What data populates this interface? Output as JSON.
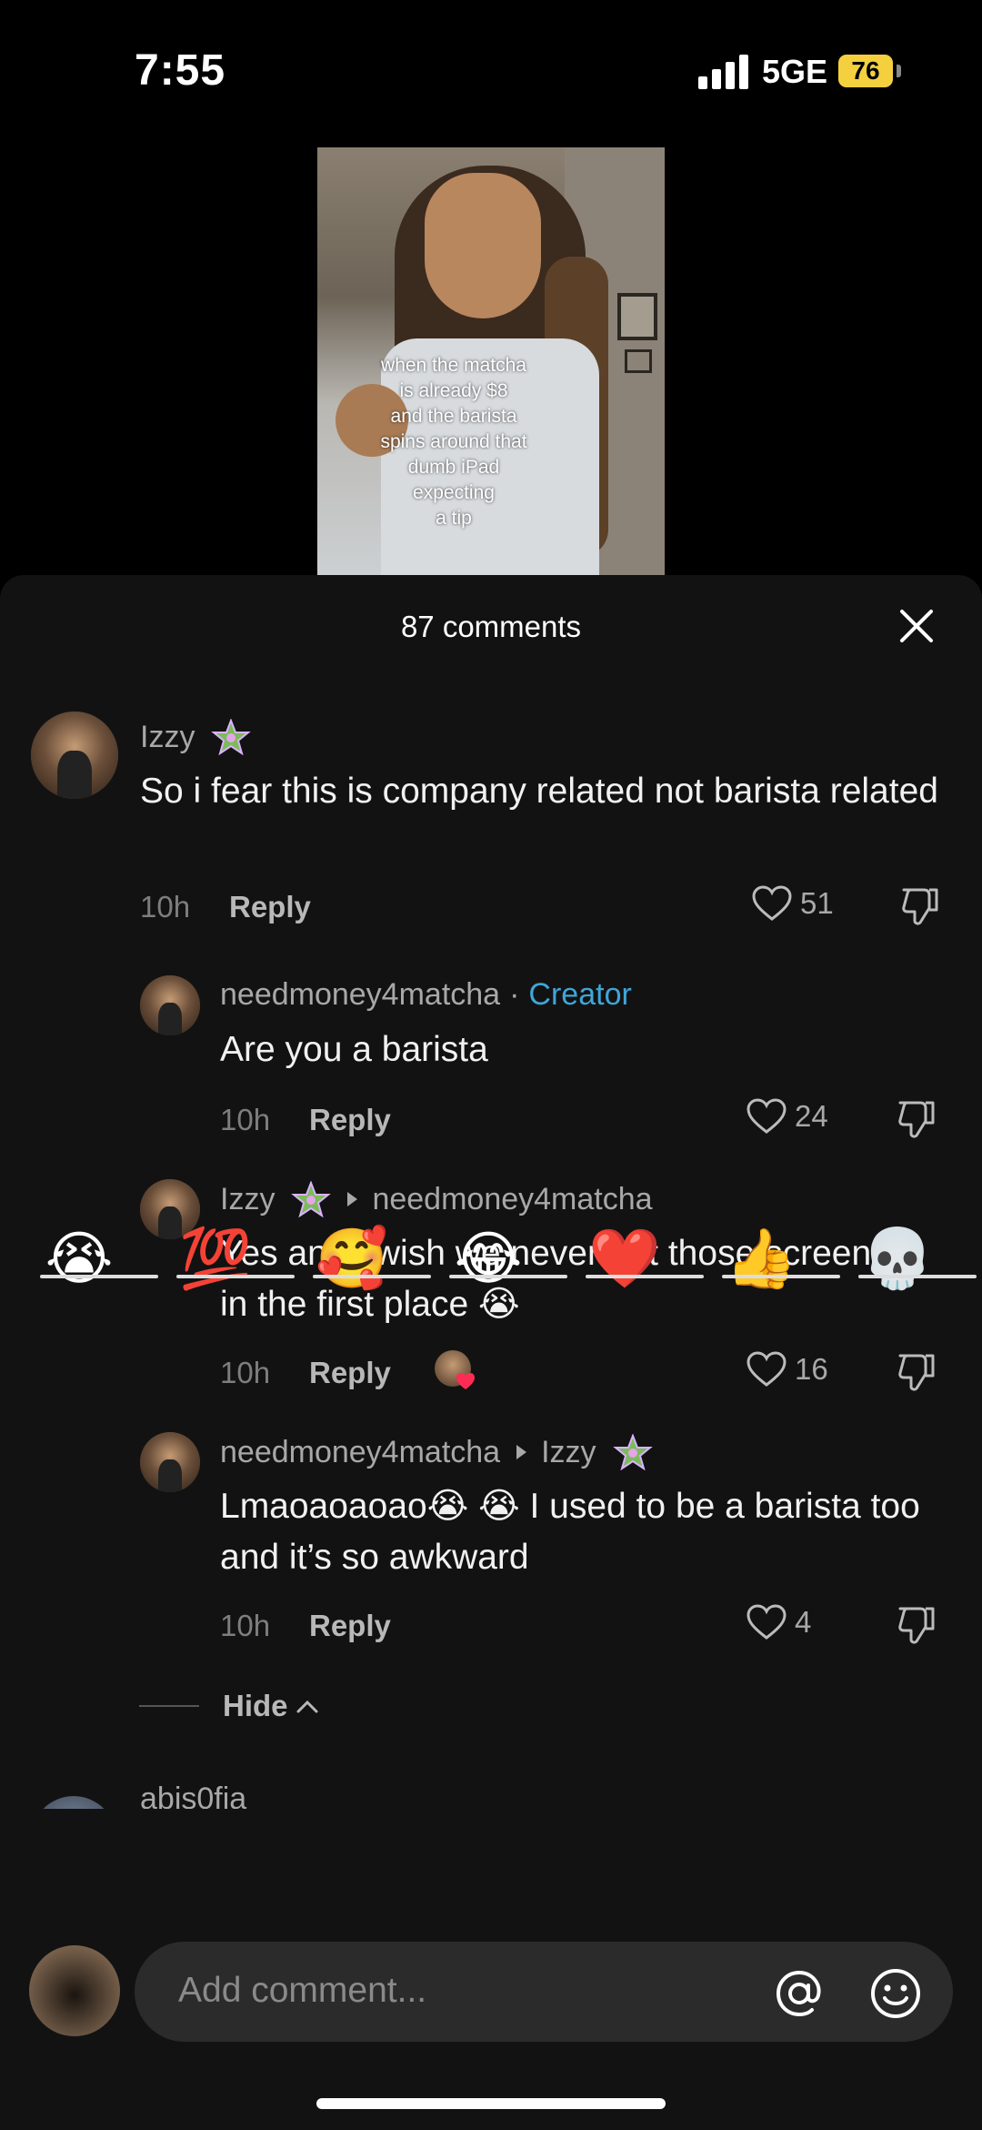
{
  "status_bar": {
    "time": "7:55",
    "network": "5GE",
    "battery": "76"
  },
  "video": {
    "caption": "when the matcha\nis already $8\nand the barista\nspins around that\ndumb iPad\nexpecting\na tip"
  },
  "sheet": {
    "title": "87 comments"
  },
  "comments": [
    {
      "username": "Izzy",
      "text": "So i fear this is company related not barista related",
      "time": "10h",
      "reply_label": "Reply",
      "likes": "51"
    },
    {
      "username": "needmoney4matcha",
      "separator": "·",
      "creator_tag": "Creator",
      "text": "Are you a barista",
      "time": "10h",
      "reply_label": "Reply",
      "likes": "24"
    },
    {
      "username": "Izzy",
      "reply_to": "needmoney4matcha",
      "text": "Yes and i wish we never got those screens in the first place 😭",
      "time": "10h",
      "reply_label": "Reply",
      "likes": "16"
    },
    {
      "username": "needmoney4matcha",
      "reply_to": "Izzy",
      "text": "Lmaoaoaoao😭 😭 I used to be a barista too and it’s so awkward",
      "time": "10h",
      "reply_label": "Reply",
      "likes": "4"
    }
  ],
  "hide_label": "Hide",
  "next_comment": {
    "username": "abis0fia"
  },
  "emoji_bar": [
    "😭",
    "💯",
    "🥰",
    "😂",
    "❤️",
    "👍",
    "💀"
  ],
  "input": {
    "placeholder": "Add comment..."
  },
  "colors": {
    "creator": "#3fa6d9",
    "sheet_bg": "#121212",
    "input_bg": "#2b2b2b",
    "battery": "#f4d03f"
  }
}
